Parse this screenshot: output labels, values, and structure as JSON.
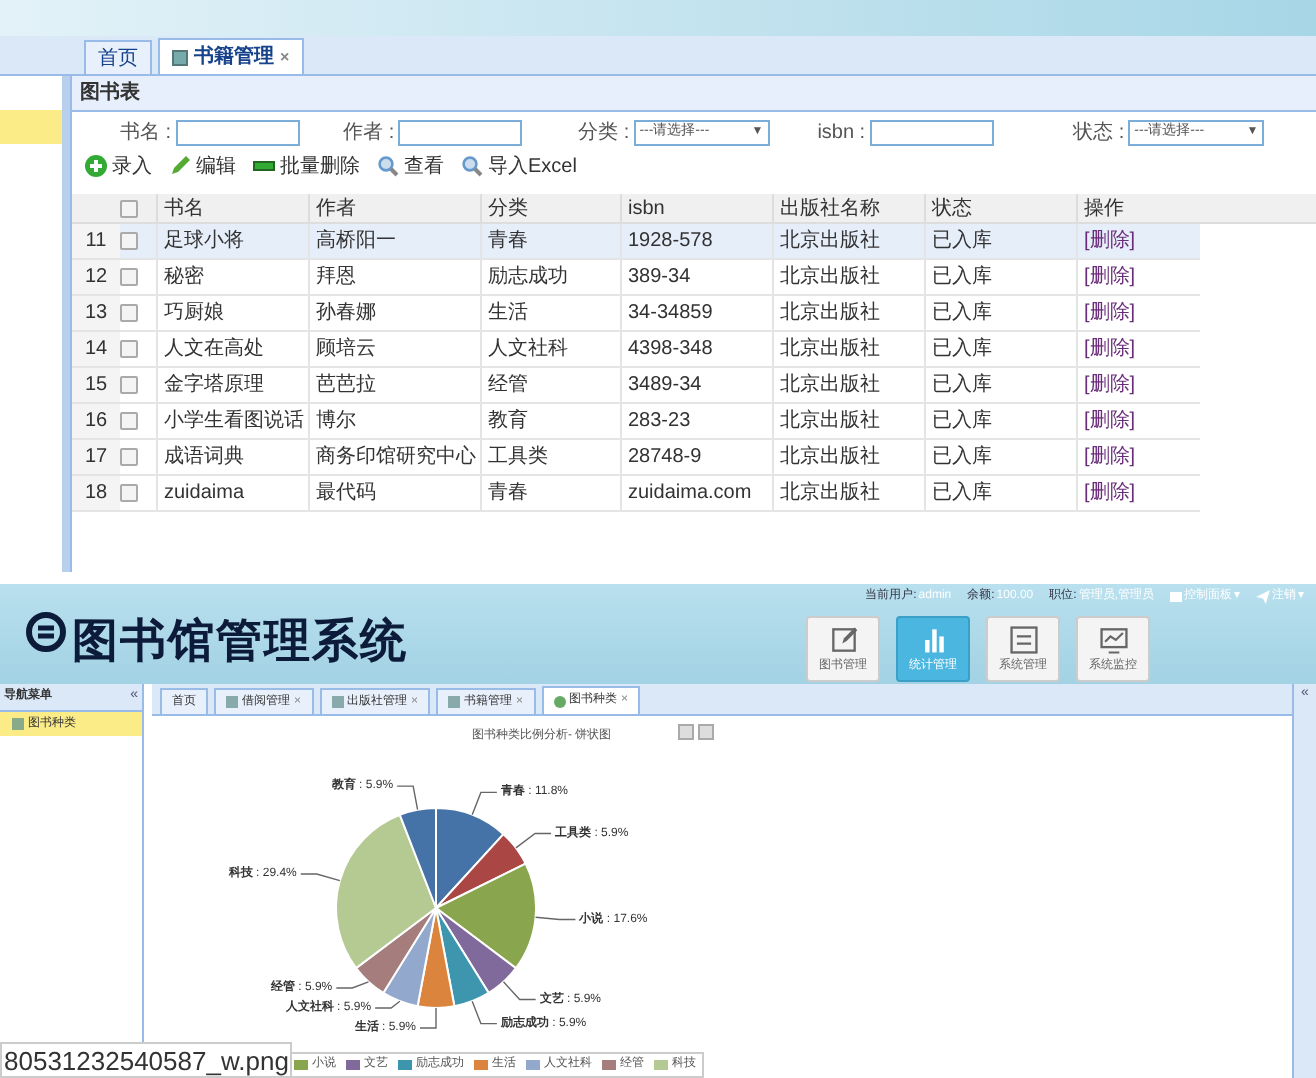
{
  "top_screen": {
    "tabs": [
      {
        "label": "首页",
        "selected": false
      },
      {
        "label": "书籍管理",
        "selected": true,
        "close": "×"
      }
    ],
    "panel": {
      "title": "图书表",
      "filters": [
        {
          "label": "书名 :",
          "kind": "input"
        },
        {
          "label": "作者 :",
          "kind": "input"
        },
        {
          "label": "分类 :",
          "kind": "select",
          "value": "---请选择---",
          "caret": "▼"
        },
        {
          "label": "isbn :",
          "kind": "input"
        },
        {
          "label": "状态 :",
          "kind": "select",
          "value": "---请选择---",
          "caret": "▼"
        }
      ],
      "toolbar": [
        {
          "label": "录入",
          "kind": "add"
        },
        {
          "label": "编辑",
          "kind": "edit"
        },
        {
          "label": "批量删除",
          "kind": "remove"
        },
        {
          "label": "查看",
          "kind": "search"
        },
        {
          "label": "导入Excel",
          "kind": "search"
        }
      ],
      "table": {
        "header_checked": false,
        "columns": [
          "书名",
          "作者",
          "分类",
          "isbn",
          "出版社名称",
          "状态",
          "操作"
        ],
        "rows": [
          {
            "index": "11",
            "selected": true,
            "checked": false,
            "cells": [
              "足球小将",
              "高桥阳一",
              "青春",
              "1928-578",
              "北京出版社",
              "已入库",
              "[删除]"
            ]
          },
          {
            "index": "12",
            "selected": false,
            "checked": false,
            "cells": [
              "秘密",
              "拜恩",
              "励志成功",
              "389-34",
              "北京出版社",
              "已入库",
              "[删除]"
            ]
          },
          {
            "index": "13",
            "selected": false,
            "checked": false,
            "cells": [
              "巧厨娘",
              "孙春娜",
              "生活",
              "34-34859",
              "北京出版社",
              "已入库",
              "[删除]"
            ]
          },
          {
            "index": "14",
            "selected": false,
            "checked": false,
            "cells": [
              "人文在高处",
              "顾培云",
              "人文社科",
              "4398-348",
              "北京出版社",
              "已入库",
              "[删除]"
            ]
          },
          {
            "index": "15",
            "selected": false,
            "checked": false,
            "cells": [
              "金字塔原理",
              "芭芭拉",
              "经管",
              "3489-34",
              "北京出版社",
              "已入库",
              "[删除]"
            ]
          },
          {
            "index": "16",
            "selected": false,
            "checked": false,
            "cells": [
              "小学生看图说话",
              "博尔",
              "教育",
              "283-23",
              "北京出版社",
              "已入库",
              "[删除]"
            ]
          },
          {
            "index": "17",
            "selected": false,
            "checked": false,
            "cells": [
              "成语词典",
              "商务印馆研究中心",
              "工具类",
              "28748-9",
              "北京出版社",
              "已入库",
              "[删除]"
            ]
          },
          {
            "index": "18",
            "selected": false,
            "checked": false,
            "cells": [
              "zuidaima",
              "最代码",
              "青春",
              "zuidaima.com",
              "北京出版社",
              "已入库",
              "[删除]"
            ]
          }
        ]
      }
    }
  },
  "bottom_screen": {
    "logo": "图书馆管理系统",
    "user_info": [
      {
        "label": "当前用户:",
        "value": "admin"
      },
      {
        "label": "余额:",
        "value": "100.00"
      },
      {
        "label": "职位:",
        "value": "管理员,管理员"
      }
    ],
    "menus": [
      {
        "label": "控制面板",
        "kind": "panel",
        "caret": "▾"
      },
      {
        "label": "注销",
        "kind": "send",
        "caret": "▾"
      }
    ],
    "modules": [
      {
        "label": "图书管理",
        "kind": "edit",
        "selected": false
      },
      {
        "label": "统计管理",
        "kind": "chart",
        "selected": true
      },
      {
        "label": "系统管理",
        "kind": "settings",
        "selected": false
      },
      {
        "label": "系统监控",
        "kind": "monitor",
        "selected": false
      }
    ],
    "sidebar": {
      "title": "导航菜单",
      "collapse": "«",
      "items": [
        {
          "label": "图书种类",
          "selected": true
        }
      ]
    },
    "tabs": [
      {
        "label": "首页",
        "selected": false
      },
      {
        "label": "借阅管理",
        "selected": false,
        "close": "×"
      },
      {
        "label": "出版社管理",
        "selected": false,
        "close": "×"
      },
      {
        "label": "书籍管理",
        "selected": false,
        "close": "×"
      },
      {
        "label": "图书种类",
        "selected": true,
        "close": "×"
      }
    ],
    "right_panel": {
      "collapse": "«"
    },
    "chart": {
      "chart_data": {
        "type": "pie",
        "title": "图书种类比例分析- 饼状图",
        "data_labels": true,
        "categories": [
          "青春",
          "工具类",
          "小说",
          "文艺",
          "励志成功",
          "生活",
          "人文社科",
          "经管",
          "科技",
          "教育"
        ],
        "values": [
          11.8,
          5.9,
          17.6,
          5.9,
          5.9,
          5.9,
          5.9,
          5.9,
          29.4,
          5.9
        ],
        "value_labels": [
          ": 11.8%",
          ": 5.9%",
          ": 17.6%",
          ": 5.9%",
          ": 5.9%",
          ": 5.9%",
          ": 5.9%",
          ": 5.9%",
          ": 29.4%",
          ": 5.9%"
        ],
        "colors": [
          "#4572a7",
          "#aa4643",
          "#89a54e",
          "#80699b",
          "#3d96ae",
          "#db843d",
          "#92a8cd",
          "#a47d7c",
          "#b5ca92",
          "#4572a7"
        ]
      },
      "legend": [
        {
          "label": "小说",
          "color": "#89a54e"
        },
        {
          "label": "文艺",
          "color": "#80699b"
        },
        {
          "label": "励志成功",
          "color": "#3d96ae"
        },
        {
          "label": "生活",
          "color": "#db843d"
        },
        {
          "label": "人文社科",
          "color": "#92a8cd"
        },
        {
          "label": "经管",
          "color": "#a47d7c"
        },
        {
          "label": "科技",
          "color": "#b5ca92"
        }
      ]
    }
  },
  "file_caption": "80531232540587_w.png"
}
